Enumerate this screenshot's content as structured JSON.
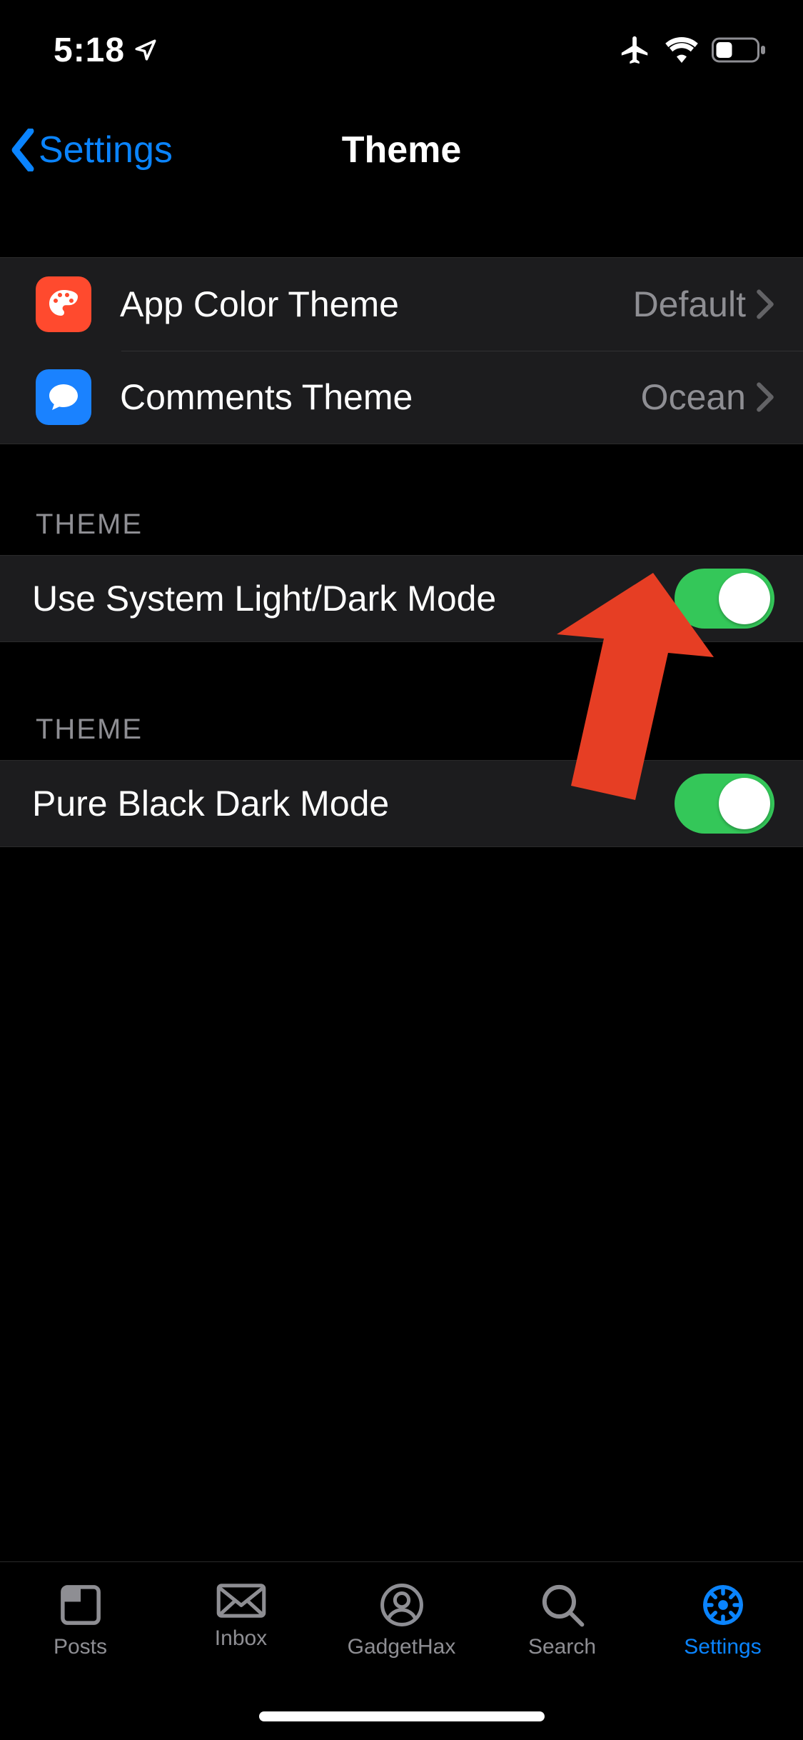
{
  "status": {
    "time": "5:18"
  },
  "nav": {
    "back_label": "Settings",
    "title": "Theme"
  },
  "section1": {
    "rows": [
      {
        "label": "App Color Theme",
        "value": "Default"
      },
      {
        "label": "Comments Theme",
        "value": "Ocean"
      }
    ]
  },
  "section2": {
    "header": "THEME",
    "row": {
      "label": "Use System Light/Dark Mode",
      "on": true
    }
  },
  "section3": {
    "header": "THEME",
    "row": {
      "label": "Pure Black Dark Mode",
      "on": true
    }
  },
  "tabs": [
    {
      "label": "Posts"
    },
    {
      "label": "Inbox"
    },
    {
      "label": "GadgetHax"
    },
    {
      "label": "Search"
    },
    {
      "label": "Settings"
    }
  ],
  "colors": {
    "accent": "#0a84ff",
    "toggle_on": "#34c759",
    "arrow": "#e63e24"
  }
}
